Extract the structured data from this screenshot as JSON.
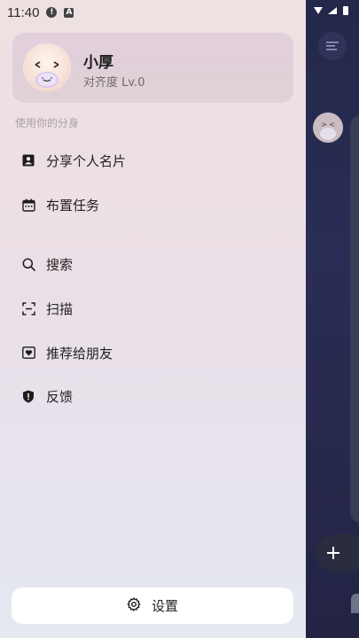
{
  "status_bar": {
    "time": "11:40"
  },
  "profile": {
    "name": "小厚",
    "level": "对齐度 Lv.0"
  },
  "section_label": "使用你的分身",
  "menu": [
    {
      "label": "分享个人名片",
      "icon": "id-card-icon"
    },
    {
      "label": "布置任务",
      "icon": "calendar-icon"
    },
    {
      "label": "搜索",
      "icon": "search-icon"
    },
    {
      "label": "扫描",
      "icon": "scan-icon"
    },
    {
      "label": "推荐给朋友",
      "icon": "heart-box-icon"
    },
    {
      "label": "反馈",
      "icon": "shield-alert-icon"
    }
  ],
  "settings": {
    "label": "设置",
    "icon": "gear-icon"
  },
  "colors": {
    "drawer_top": "#efe1e1",
    "drawer_bottom": "#e4eaf0",
    "card": "#e2cfdd",
    "dark_bg": "#24284a"
  }
}
